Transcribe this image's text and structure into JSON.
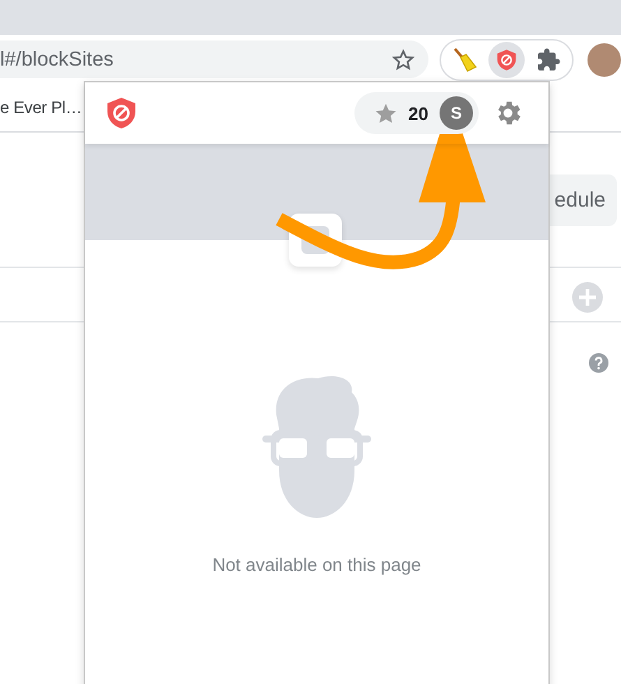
{
  "browser": {
    "address": "l#/blockSites",
    "bookmark": "e Ever Pl…",
    "extensions": [
      {
        "kind": "broom",
        "selected": false
      },
      {
        "kind": "shield",
        "selected": true
      },
      {
        "kind": "puzzle",
        "selected": false
      }
    ]
  },
  "page": {
    "button": "edule"
  },
  "popup": {
    "points": "20",
    "user_initial": "S",
    "message": "Not available on this page"
  }
}
